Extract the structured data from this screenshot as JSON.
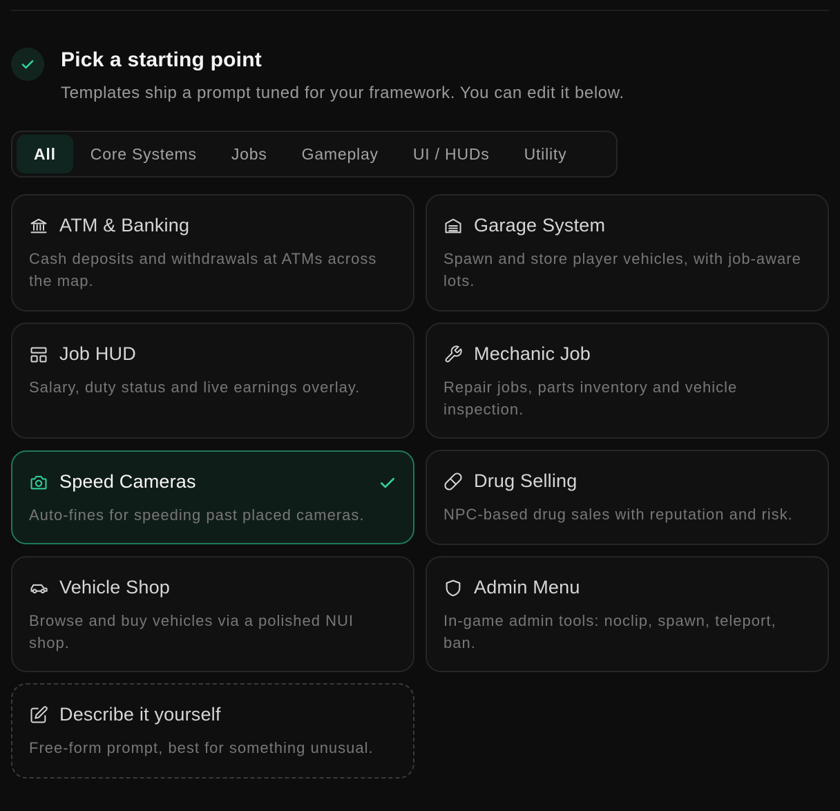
{
  "header": {
    "title": "Pick a starting point",
    "subtitle": "Templates ship a prompt tuned for your framework. You can edit it below.",
    "step_icon": "check-icon"
  },
  "tabs": [
    {
      "label": "All",
      "active": true
    },
    {
      "label": "Core Systems",
      "active": false
    },
    {
      "label": "Jobs",
      "active": false
    },
    {
      "label": "Gameplay",
      "active": false
    },
    {
      "label": "UI / HUDs",
      "active": false
    },
    {
      "label": "Utility",
      "active": false
    }
  ],
  "templates": [
    {
      "title": "ATM & Banking",
      "description": "Cash deposits and withdrawals at ATMs across the map.",
      "icon": "bank-icon",
      "selected": false
    },
    {
      "title": "Garage System",
      "description": "Spawn and store player vehicles, with job-aware lots.",
      "icon": "garage-icon",
      "selected": false
    },
    {
      "title": "Job HUD",
      "description": "Salary, duty status and live earnings overlay.",
      "icon": "layout-icon",
      "selected": false
    },
    {
      "title": "Mechanic Job",
      "description": "Repair jobs, parts inventory and vehicle inspection.",
      "icon": "wrench-icon",
      "selected": false
    },
    {
      "title": "Speed Cameras",
      "description": "Auto-fines for speeding past placed cameras.",
      "icon": "camera-icon",
      "selected": true
    },
    {
      "title": "Drug Selling",
      "description": "NPC-based drug sales with reputation and risk.",
      "icon": "pill-icon",
      "selected": false
    },
    {
      "title": "Vehicle Shop",
      "description": "Browse and buy vehicles via a polished NUI shop.",
      "icon": "car-icon",
      "selected": false
    },
    {
      "title": "Admin Menu",
      "description": "In-game admin tools: noclip, spawn, teleport, ban.",
      "icon": "shield-icon",
      "selected": false
    },
    {
      "title": "Describe it yourself",
      "description": "Free-form prompt, best for something unusual.",
      "icon": "edit-icon",
      "selected": false
    }
  ],
  "colors": {
    "accent": "#34d399",
    "background": "#0d0d0d",
    "card": "#111111",
    "selected_border": "#1e7a55"
  }
}
